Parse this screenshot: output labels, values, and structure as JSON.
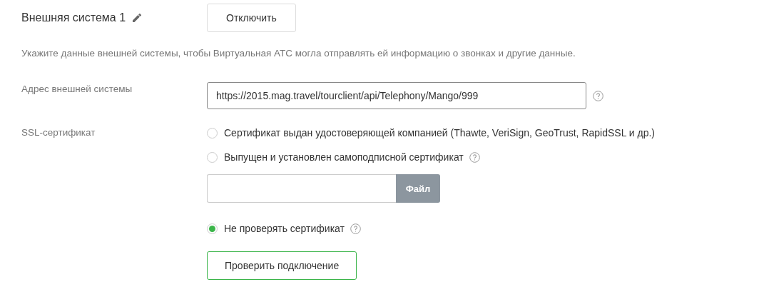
{
  "header": {
    "title": "Внешняя система 1",
    "button": "Отключить"
  },
  "description": "Укажите данные внешней системы, чтобы Виртуальная АТС могла отправлять ей информацию о звонках и другие данные.",
  "address": {
    "label": "Адрес внешней системы",
    "value": "https://2015.mag.travel/tourclient/api/Telephony/Mango/999"
  },
  "ssl": {
    "label": "SSL-сертификат",
    "options": [
      {
        "label": "Сертификат выдан удостоверяющей компанией (Thawte, VeriSign, GeoTrust, RapidSSL и др.)",
        "selected": false,
        "help": false
      },
      {
        "label": "Выпущен и установлен самоподписной сертификат",
        "selected": false,
        "help": true
      },
      {
        "label": "Не проверять сертификат",
        "selected": true,
        "help": true
      }
    ],
    "file_button": "Файл"
  },
  "check_button": "Проверить подключение"
}
